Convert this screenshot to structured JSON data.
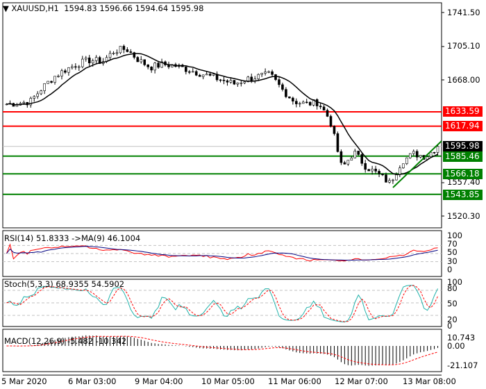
{
  "header": {
    "symbol": "XAUUSD,H1",
    "open": "1594.83",
    "high": "1596.66",
    "low": "1594.64",
    "close": "1595.98"
  },
  "price_axis": [
    "1741.50",
    "1705.10",
    "1668.00",
    "1557.40",
    "1520.30"
  ],
  "levels": [
    {
      "label": "1633.59",
      "value": 1633.59,
      "color": "#ff0000"
    },
    {
      "label": "1617.94",
      "value": 1617.94,
      "color": "#ff0000"
    },
    {
      "label": "1585.46",
      "value": 1585.46,
      "color": "#008000"
    },
    {
      "label": "1566.18",
      "value": 1566.18,
      "color": "#008000"
    },
    {
      "label": "1543.85",
      "value": 1543.85,
      "color": "#008000"
    }
  ],
  "current_price": {
    "label": "1595.98",
    "value": 1595.98
  },
  "rsi": {
    "label": "RSI(14) 51.8333  ->MA(9) 46.1004",
    "axis": [
      "100",
      "70",
      "50",
      "30",
      "0"
    ]
  },
  "stoch": {
    "label": "Stoch(5,3,3) 68.9355 54.5902",
    "axis": [
      "100",
      "80",
      "50",
      "20",
      "0"
    ]
  },
  "macd": {
    "label": "MACD(12,26,9) -5.482 -10.342",
    "axis": [
      "10.743",
      "0.00",
      "-21.107"
    ]
  },
  "time_axis": [
    "5 Mar 2020",
    "6 Mar 03:00",
    "9 Mar 04:00",
    "10 Mar 05:00",
    "11 Mar 06:00",
    "12 Mar 07:00",
    "13 Mar 08:00"
  ],
  "chart_data": {
    "type": "candlestick",
    "title": "XAUUSD,H1",
    "ylim": [
      1510,
      1750
    ],
    "key_closes": [
      1642,
      1643,
      1645,
      1660,
      1672,
      1680,
      1686,
      1690,
      1688,
      1700,
      1702,
      1690,
      1682,
      1685,
      1684,
      1680,
      1676,
      1672,
      1668,
      1664,
      1669,
      1672,
      1674,
      1658,
      1645,
      1642,
      1644,
      1625,
      1572,
      1590,
      1574,
      1566,
      1556,
      1580,
      1588,
      1585,
      1596
    ]
  }
}
